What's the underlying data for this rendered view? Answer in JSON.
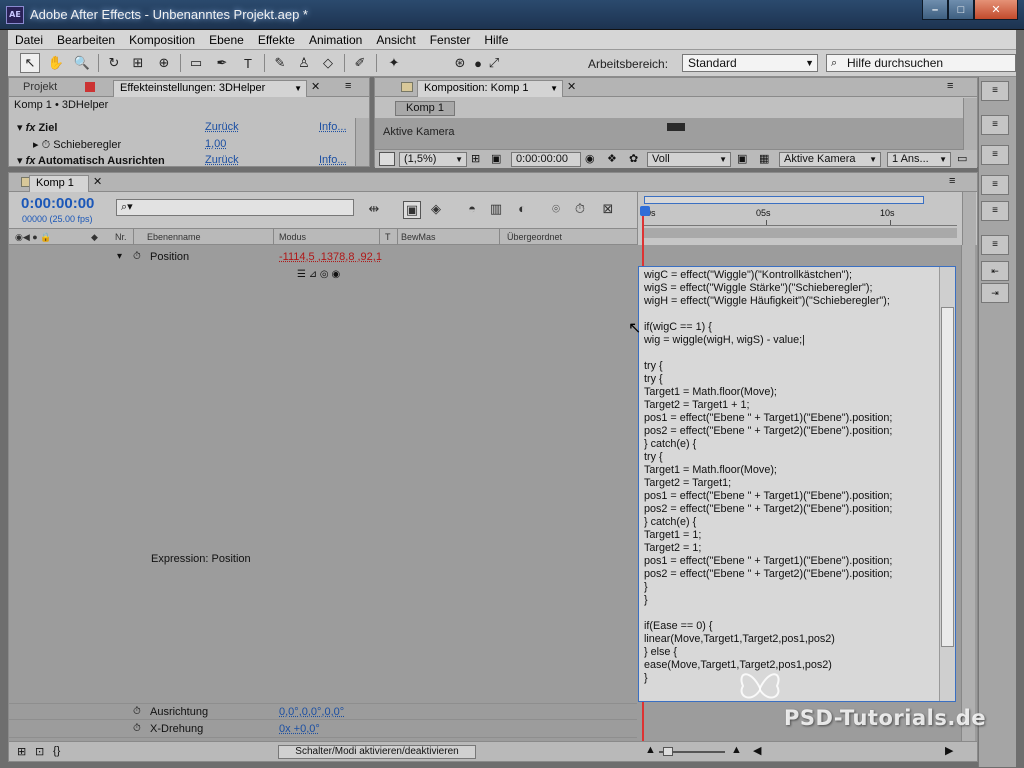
{
  "window": {
    "title": "Adobe After Effects - Unbenanntes Projekt.aep *",
    "app_icon": "AE",
    "min_label": "–",
    "max_label": "□",
    "close_label": "✕"
  },
  "menu": [
    "Datei",
    "Bearbeiten",
    "Komposition",
    "Ebene",
    "Effekte",
    "Animation",
    "Ansicht",
    "Fenster",
    "Hilfe"
  ],
  "toolbar": {
    "workspace_label": "Arbeitsbereich:",
    "workspace_value": "Standard",
    "help_search_placeholder": "Hilfe durchsuchen"
  },
  "project_panel": {
    "tab_project": "Projekt",
    "tab_effects": "Effekteinstellungen: 3DHelper",
    "header": "Komp 1 • 3DHelper",
    "rows": [
      {
        "label": "Ziel",
        "reset": "Zurück",
        "info": "Info..."
      },
      {
        "label": "Schieberegler",
        "value": "1,00"
      },
      {
        "label": "Automatisch Ausrichten",
        "reset": "Zurück",
        "info": "Info..."
      }
    ]
  },
  "comp_panel": {
    "tab": "Komposition: Komp 1",
    "sub_tab": "Komp 1",
    "camera_label": "Aktive Kamera",
    "zoom": "(1,5%)",
    "timecode": "0:00:00:00",
    "resolution": "Voll",
    "camera_select": "Aktive Kamera",
    "views": "1 Ans..."
  },
  "timeline": {
    "tab": "Komp 1",
    "timecode": "0:00:00:00",
    "fps": "00000 (25.00 fps)",
    "search_placeholder": "⌕▾",
    "columns": {
      "nr": "Nr.",
      "layer_name": "Ebenenname",
      "mode": "Modus",
      "t": "T",
      "trkmat": "BewMas",
      "parent": "Übergeordnet"
    },
    "ruler": {
      "t0": "0s",
      "t1": "05s",
      "t2": "10s"
    },
    "position_label": "Position",
    "position_value": "-1114,5 ,1378,8 ,92,1",
    "expression_label": "Expression: Position",
    "orientation_label": "Ausrichtung",
    "orientation_value": "0,0°,0,0°,0,0°",
    "xrot_label": "X-Drehung",
    "xrot_value": "0x +0,0°",
    "toggle_label": "Schalter/Modi aktivieren/deaktivieren"
  },
  "expression": [
    "wigC = effect(\"Wiggle\")(\"Kontrollkästchen\");",
    "wigS = effect(\"Wiggle Stärke\")(\"Schieberegler\");",
    "wigH = effect(\"Wiggle Häufigkeit\")(\"Schieberegler\");",
    "",
    "if(wigC == 1) {",
    "wig = wiggle(wigH, wigS) - value;|",
    "",
    "try {",
    "try {",
    "Target1 = Math.floor(Move);",
    "Target2 = Target1 + 1;",
    "pos1 = effect(\"Ebene \" + Target1)(\"Ebene\").position;",
    "pos2 = effect(\"Ebene \" + Target2)(\"Ebene\").position;",
    "} catch(e) {",
    "try {",
    "Target1 = Math.floor(Move);",
    "Target2 = Target1;",
    "pos1 = effect(\"Ebene \" + Target1)(\"Ebene\").position;",
    "pos2 = effect(\"Ebene \" + Target2)(\"Ebene\").position;",
    "} catch(e) {",
    "Target1 = 1;",
    "Target2 = 1;",
    "pos1 = effect(\"Ebene \" + Target1)(\"Ebene\").position;",
    "pos2 = effect(\"Ebene \" + Target2)(\"Ebene\").position;",
    "}",
    "}",
    "",
    "if(Ease == 0) {",
    "linear(Move,Target1,Target2,pos1,pos2)",
    "} else {",
    "ease(Move,Target1,Target2,pos1,pos2)",
    "}"
  ],
  "watermark": "PSD-Tutorials.de",
  "colors": {
    "accent_blue": "#1b57b8",
    "value_red": "#b01818",
    "cti": "#d33333"
  }
}
